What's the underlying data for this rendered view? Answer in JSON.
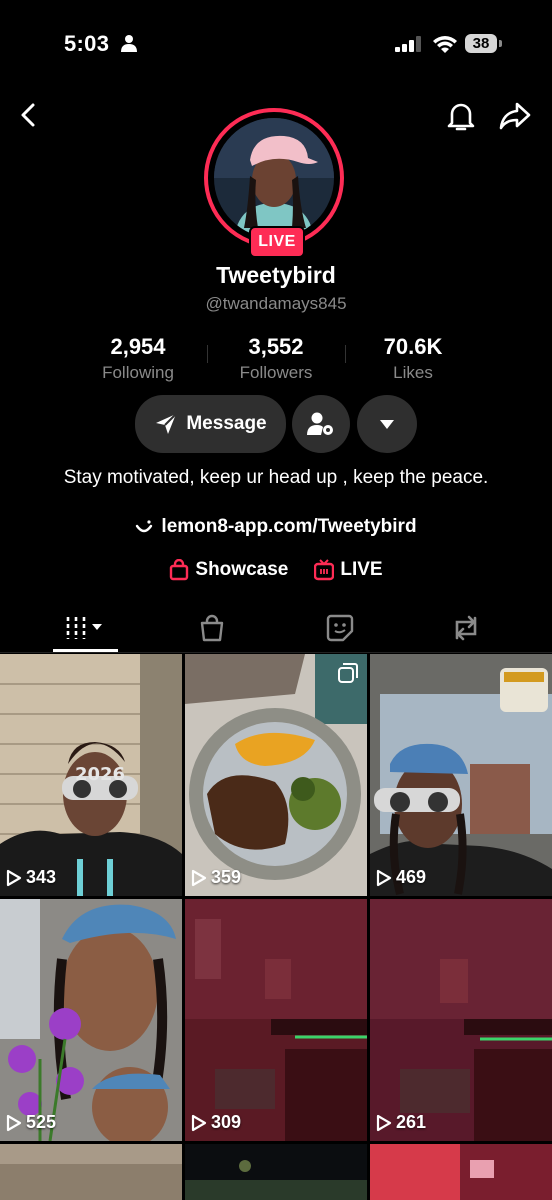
{
  "status_bar": {
    "time": "5:03",
    "battery": "38"
  },
  "profile": {
    "live_badge": "LIVE",
    "display_name": "Tweetybird",
    "username": "@twandamays845",
    "bio": "Stay motivated,  keep ur head up , keep the peace.",
    "link": "lemon8-app.com/Tweetybird"
  },
  "stats": [
    {
      "value": "2,954",
      "label": "Following"
    },
    {
      "value": "3,552",
      "label": "Followers"
    },
    {
      "value": "70.6K",
      "label": "Likes"
    }
  ],
  "actions": {
    "message_label": "Message"
  },
  "chips": {
    "showcase": "Showcase",
    "live": "LIVE"
  },
  "tabs": [
    {
      "icon": "videos-grid-icon",
      "active": true
    },
    {
      "icon": "shopping-bag-icon",
      "active": false
    },
    {
      "icon": "favorites-sticker-icon",
      "active": false
    },
    {
      "icon": "repost-icon",
      "active": false
    }
  ],
  "videos": [
    {
      "views": "343"
    },
    {
      "views": "359"
    },
    {
      "views": "469"
    },
    {
      "views": "525"
    },
    {
      "views": "309"
    },
    {
      "views": "261"
    }
  ],
  "colors": {
    "accent": "#fe2c55",
    "background": "#000000",
    "button": "#2f2f2f",
    "muted_text": "#8a8a8a"
  }
}
